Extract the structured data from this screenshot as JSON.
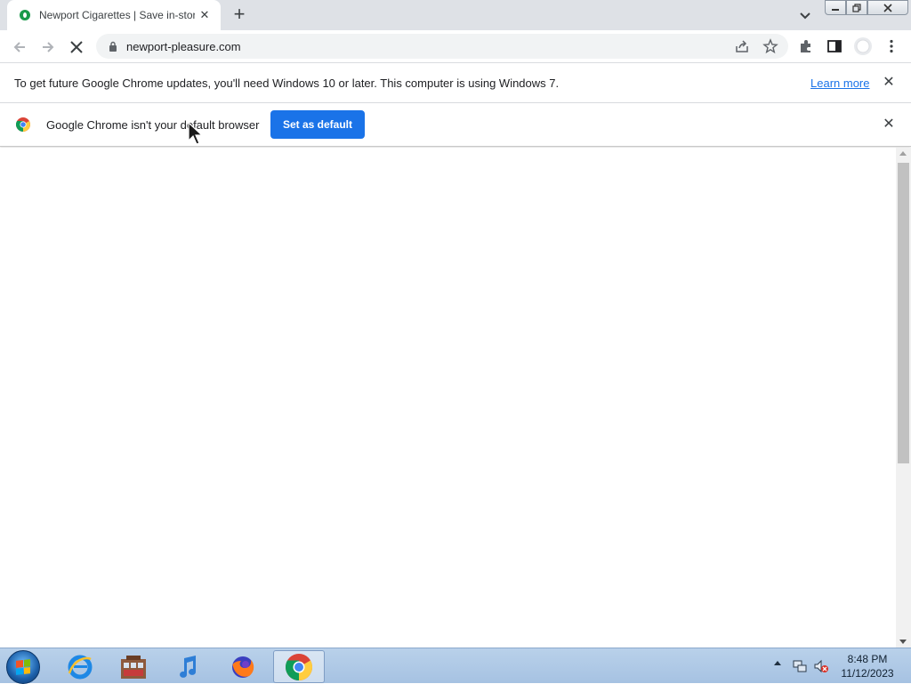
{
  "tab": {
    "title": "Newport Cigarettes | Save in-store",
    "close_label": "✕",
    "new_tab_label": "+"
  },
  "toolbar": {
    "url": "newport-pleasure.com"
  },
  "infobar_update": {
    "message": "To get future Google Chrome updates, you'll need Windows 10 or later. This computer is using Windows 7.",
    "link_label": "Learn more",
    "close_label": "✕"
  },
  "infobar_default": {
    "message": "Google Chrome isn't your default browser",
    "button_label": "Set as default",
    "close_label": "✕"
  },
  "taskbar": {
    "apps": [
      "Internet Explorer",
      "Windows Media Center",
      "iTunes",
      "Firefox",
      "Google Chrome"
    ],
    "active_app": "Google Chrome",
    "time": "8:48 PM",
    "date": "11/12/2023"
  },
  "colors": {
    "accent": "#1a73e8",
    "tabstrip": "#dee1e6",
    "omnibox": "#f1f3f4"
  }
}
